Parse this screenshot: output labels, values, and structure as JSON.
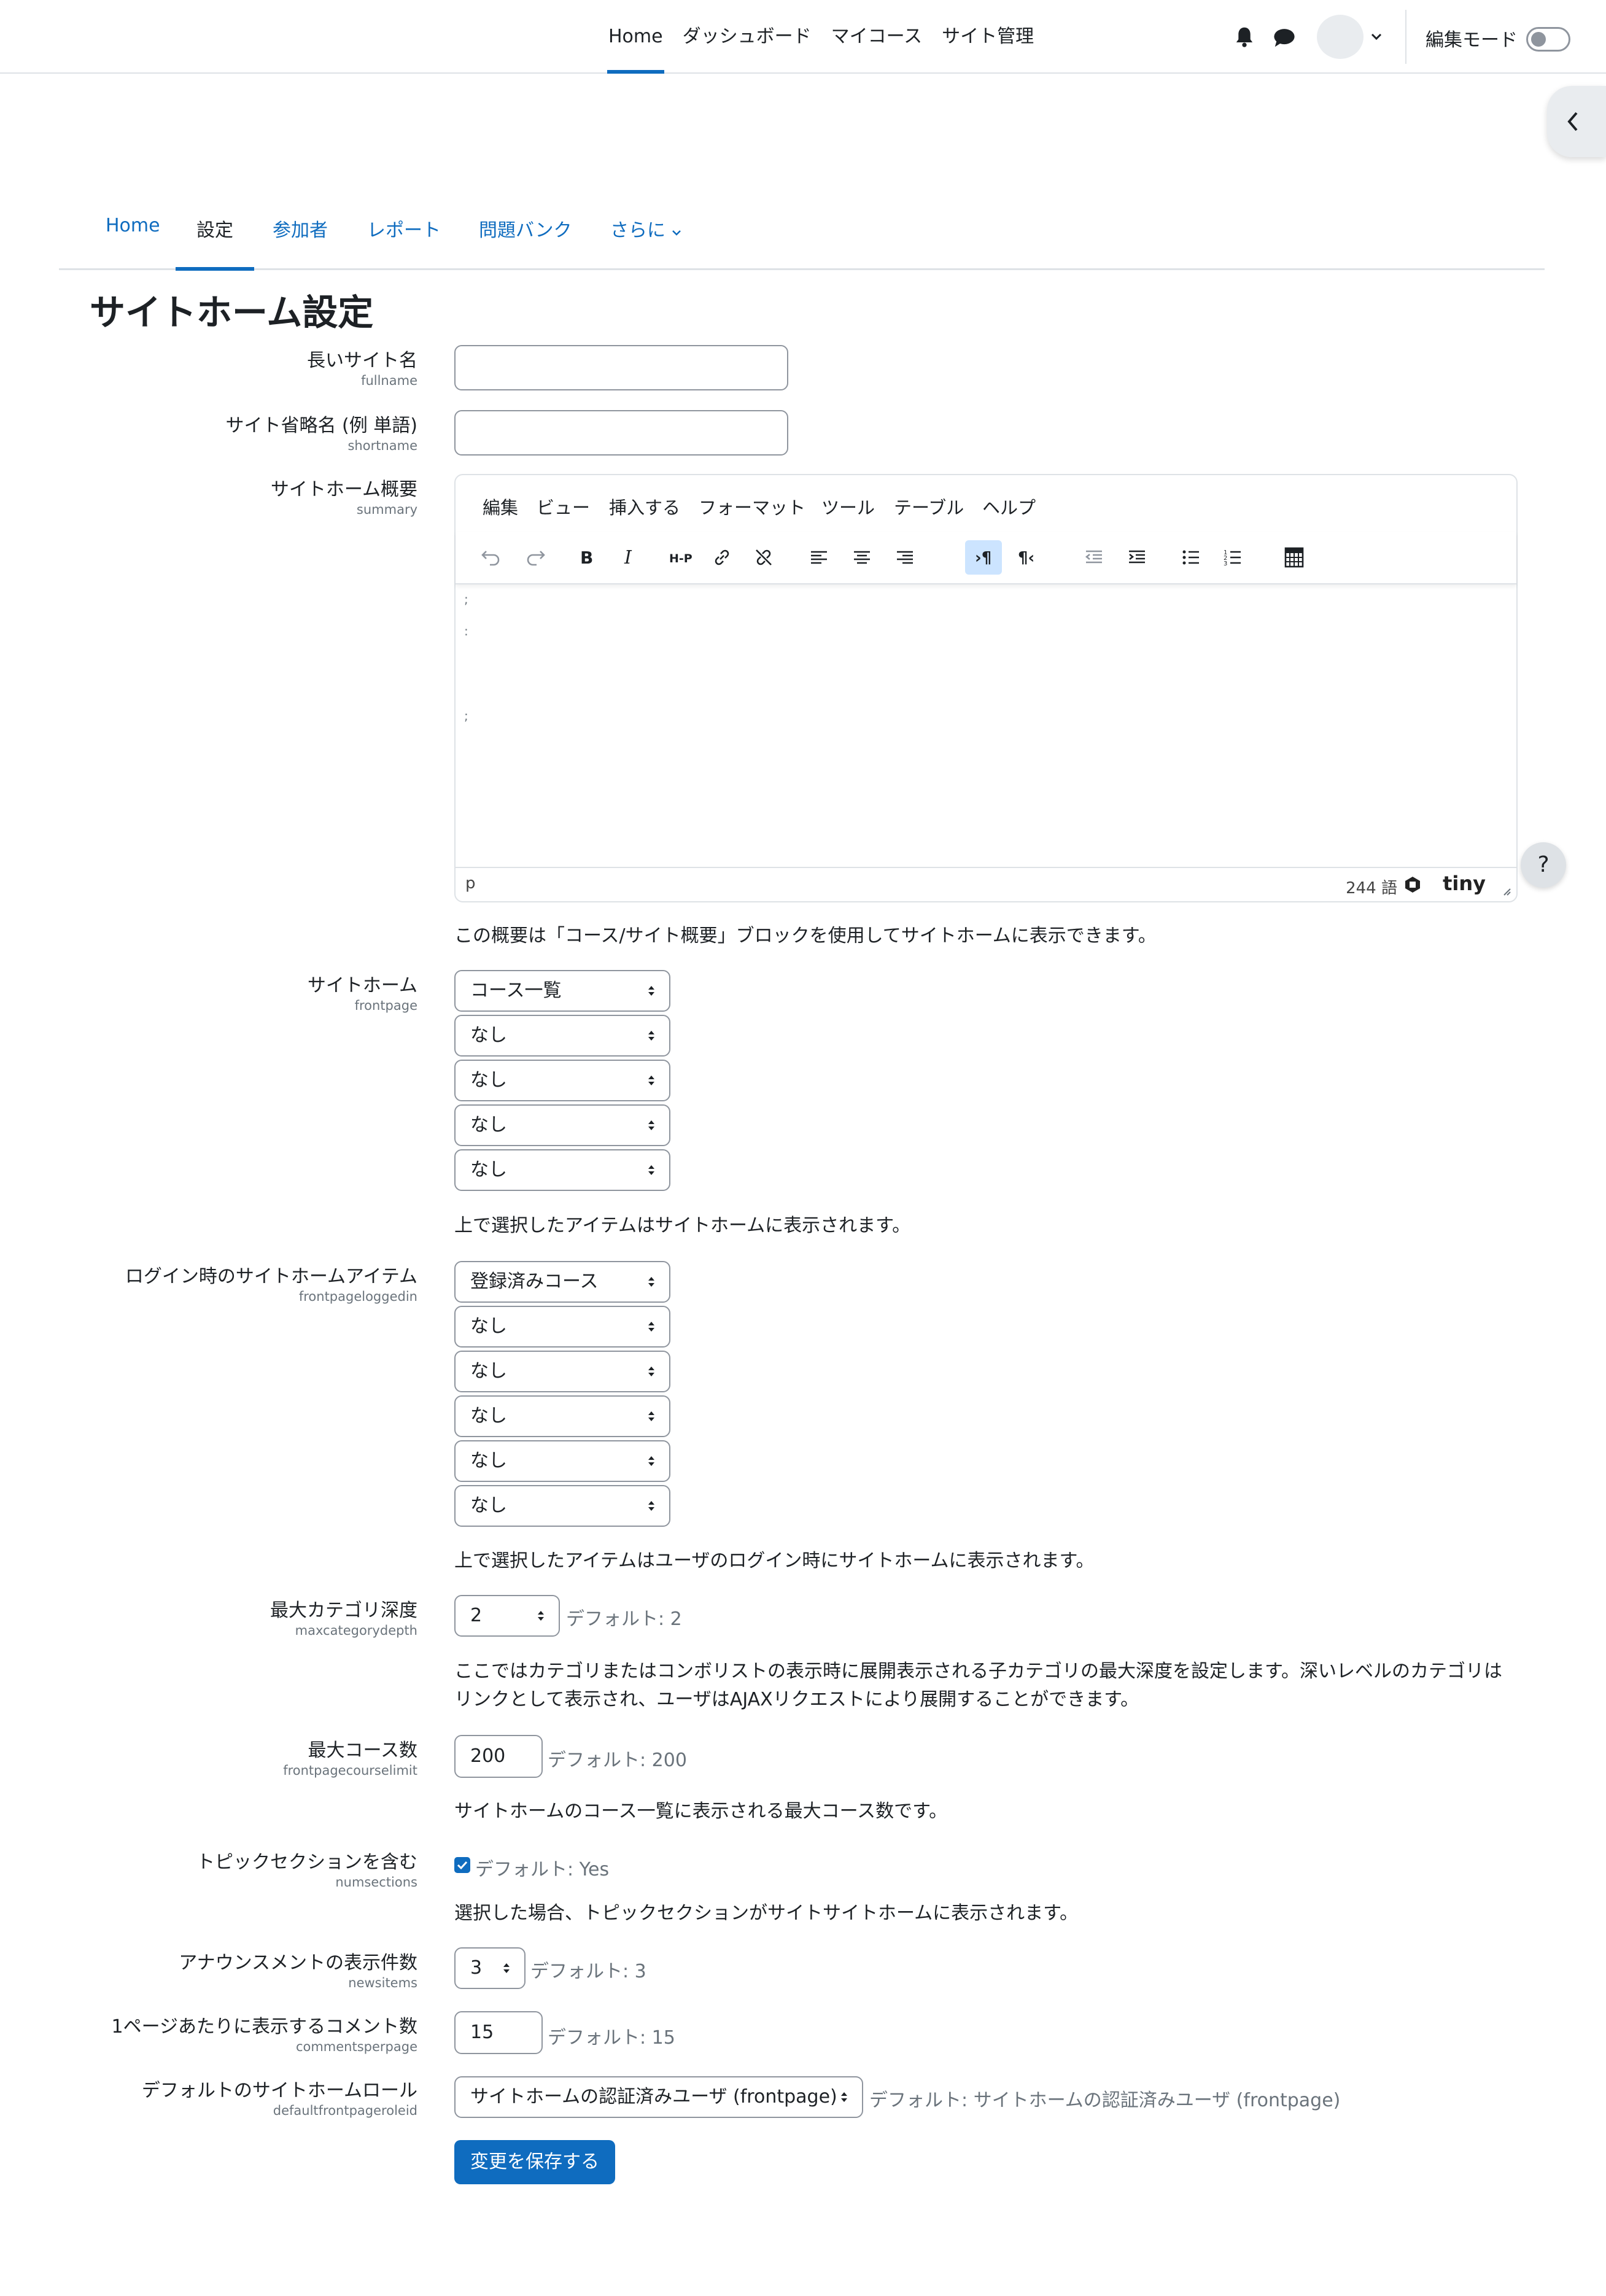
{
  "navbar": {
    "items": [
      "Home",
      "ダッシュボード",
      "マイコース",
      "サイト管理"
    ],
    "active": "Home",
    "edit_mode_label": "編集モード",
    "edit_mode_on": false,
    "icons": [
      "bell-icon",
      "chat-icon",
      "chevron-down-icon"
    ]
  },
  "secondary_nav": {
    "tabs": [
      "Home",
      "設定",
      "参加者",
      "レポート",
      "問題バンク",
      "さらに"
    ],
    "active": "設定"
  },
  "page_title": "サイトホーム設定",
  "fields": {
    "fullname": {
      "label": "長いサイト名",
      "name": "fullname",
      "value": ""
    },
    "shortname": {
      "label": "サイト省略名 (例 単語)",
      "name": "shortname",
      "value": ""
    },
    "summary": {
      "label": "サイトホーム概要",
      "name": "summary",
      "menu": [
        "編集",
        "ビュー",
        "挿入する",
        "フォーマット",
        "ツール",
        "テーブル",
        "ヘルプ"
      ],
      "status_path": "p",
      "word_count": "244 語",
      "brand": "tiny",
      "help": "この概要は「コース/サイト概要」ブロックを使用してサイトホームに表示できます。"
    },
    "frontpage": {
      "label": "サイトホーム",
      "name": "frontpage",
      "selects": [
        "コース一覧",
        "なし",
        "なし",
        "なし",
        "なし"
      ],
      "help": "上で選択したアイテムはサイトホームに表示されます。"
    },
    "frontpageloggedin": {
      "label": "ログイン時のサイトホームアイテム",
      "name": "frontpageloggedin",
      "selects": [
        "登録済みコース",
        "なし",
        "なし",
        "なし",
        "なし",
        "なし"
      ],
      "help": "上で選択したアイテムはユーザのログイン時にサイトホームに表示されます。"
    },
    "maxcategorydepth": {
      "label": "最大カテゴリ深度",
      "name": "maxcategorydepth",
      "value": "2",
      "default": "デフォルト: 2",
      "help_line1": "ここではカテゴリまたはコンボリストの表示時に展開表示される子カテゴリの最大深度を設定します。深いレベルのカテゴリは",
      "help_line2": "リンクとして表示され、ユーザはAJAXリクエストにより展開することができます。"
    },
    "frontpagecourselimit": {
      "label": "最大コース数",
      "name": "frontpagecourselimit",
      "value": "200",
      "default": "デフォルト: 200",
      "help": "サイトホームのコース一覧に表示される最大コース数です。"
    },
    "numsections": {
      "label": "トピックセクションを含む",
      "name": "numsections",
      "checked": true,
      "default": "デフォルト: Yes",
      "help": "選択した場合、トピックセクションがサイトサイトホームに表示されます。"
    },
    "newsitems": {
      "label": "アナウンスメントの表示件数",
      "name": "newsitems",
      "value": "3",
      "default": "デフォルト: 3"
    },
    "commentsperpage": {
      "label": "1ページあたりに表示するコメント数",
      "name": "commentsperpage",
      "value": "15",
      "default": "デフォルト: 15"
    },
    "defaultfrontpageroleid": {
      "label": "デフォルトのサイトホームロール",
      "name": "defaultfrontpageroleid",
      "value": "サイトホームの認証済みユーザ (frontpage)",
      "default": "デフォルト: サイトホームの認証済みユーザ (frontpage)"
    }
  },
  "save_button": "変更を保存する",
  "help_button": "?",
  "colors": {
    "primary": "#0f6cbf",
    "text": "#1d2125",
    "muted": "#6a737b",
    "border": "#8f959e"
  }
}
